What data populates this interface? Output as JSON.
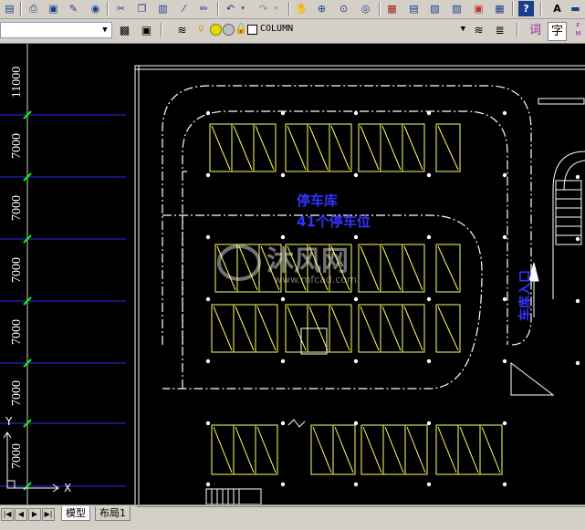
{
  "toolbar": {
    "layer_combo_value": "",
    "linetype_combo_value": "COLUMN",
    "char_btn_1": "词",
    "char_btn_2": "字",
    "right_letter": "A"
  },
  "drawing": {
    "dimensions": [
      "11000",
      "7000",
      "7000",
      "7000",
      "7000",
      "7000",
      "7000"
    ],
    "garage_label": "停车库",
    "spaces_label": "41个停车位",
    "entrance_label": "车库入口",
    "watermark_main": "沐风网",
    "watermark_url": "www.mfcad.com",
    "ucs_x": "X",
    "ucs_y": "Y"
  },
  "tabs": {
    "model": "模型",
    "layout1": "布局1"
  },
  "colors": {
    "background": "#000000",
    "parking_lines": "#ffff66",
    "grid_lines": "#1a1aff",
    "walls": "#ffffff",
    "text_blue": "#3333ff",
    "dim_green": "#00ff00"
  }
}
